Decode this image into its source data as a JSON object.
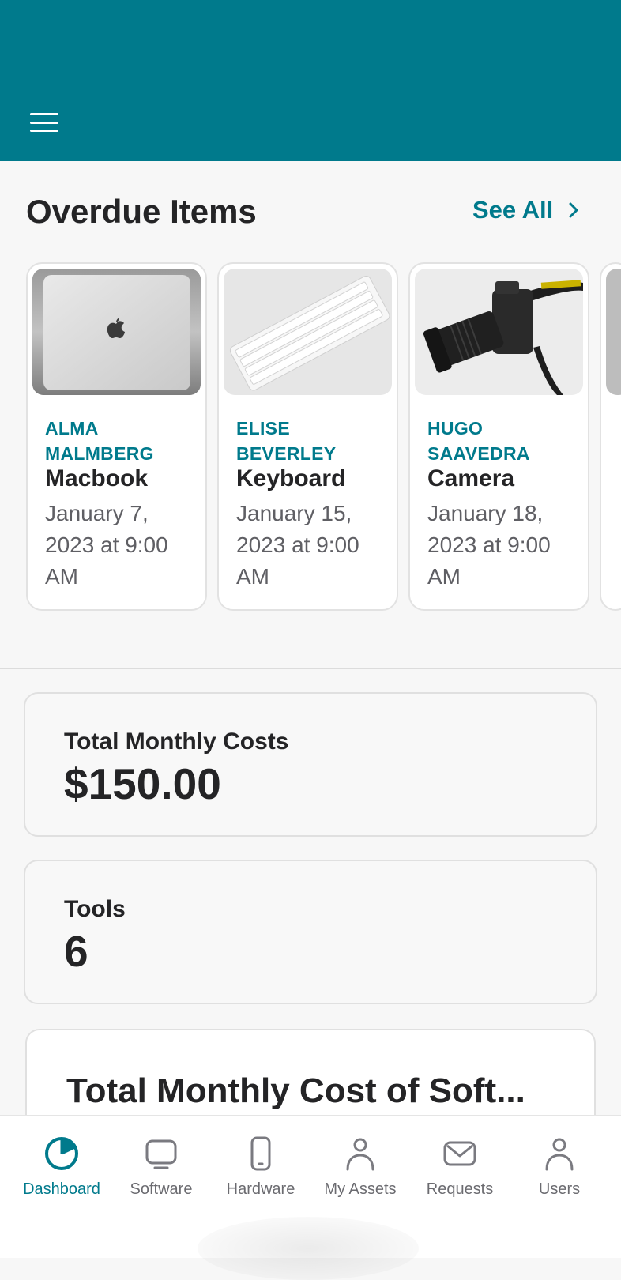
{
  "overdue": {
    "title": "Overdue Items",
    "see_all": "See All",
    "items": [
      {
        "owner": "ALMA MALMBERG",
        "item": "Macbook",
        "due": "January 7, 2023 at 9:00 AM",
        "photo": "laptop-photo"
      },
      {
        "owner": "ELISE BEVERLEY",
        "item": "Keyboard",
        "due": "January 15, 2023 at 9:00 AM",
        "photo": "keyboard-photo"
      },
      {
        "owner": "HUGO SAAVEDRA",
        "item": "Camera",
        "due": "January 18, 2023 at 9:00 AM",
        "photo": "camera-photo"
      }
    ]
  },
  "stats": {
    "costs_label": "Total Monthly Costs",
    "costs_value": "$150.00",
    "tools_label": "Tools",
    "tools_value": "6"
  },
  "software_card": {
    "title": "Total Monthly Cost of Soft..."
  },
  "tabs": [
    {
      "label": "Dashboard",
      "icon": "dashboard-icon",
      "active": true
    },
    {
      "label": "Software",
      "icon": "monitor-icon"
    },
    {
      "label": "Hardware",
      "icon": "phone-icon"
    },
    {
      "label": "My Assets",
      "icon": "person-icon"
    },
    {
      "label": "Requests",
      "icon": "mail-icon"
    },
    {
      "label": "Users",
      "icon": "person-icon"
    }
  ],
  "colors": {
    "accent": "#007a8c",
    "text": "#242426",
    "muted": "#5f5f64",
    "background": "#f7f7f7"
  }
}
